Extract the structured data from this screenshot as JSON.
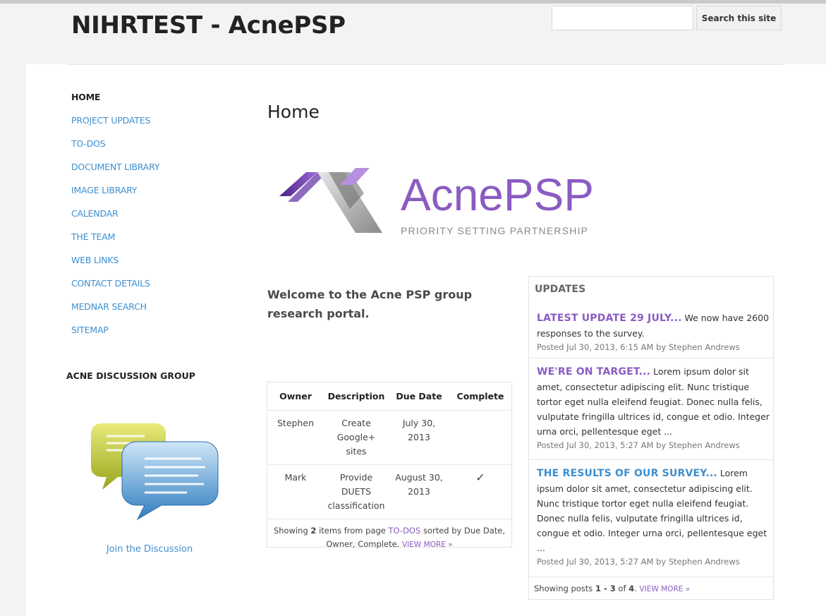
{
  "site": {
    "title": "NIHRTEST - AcnePSP",
    "search_button": "Search this site",
    "search_value": ""
  },
  "nav": {
    "items": [
      {
        "label": "HOME",
        "active": true
      },
      {
        "label": "PROJECT UPDATES"
      },
      {
        "label": "TO-DOS"
      },
      {
        "label": "DOCUMENT LIBRARY"
      },
      {
        "label": "IMAGE LIBRARY"
      },
      {
        "label": "CALENDAR"
      },
      {
        "label": "THE TEAM"
      },
      {
        "label": "WEB LINKS"
      },
      {
        "label": "CONTACT DETAILS"
      },
      {
        "label": "MEDNAR SEARCH"
      },
      {
        "label": "SITEMAP"
      }
    ]
  },
  "sidebar": {
    "group_title": "ACNE DISCUSSION GROUP",
    "image_icon": "chat-bubbles-icon",
    "join_link": "Join the Discussion"
  },
  "main": {
    "page_title": "Home",
    "logo": {
      "name": "AcnePSP",
      "tagline": "PRIORITY SETTING PARTNERSHIP"
    },
    "welcome": "Welcome to the Acne PSP group research portal.",
    "todos": {
      "headers": [
        "Owner",
        "Description",
        "Due Date",
        "Complete"
      ],
      "rows": [
        {
          "owner": "Stephen",
          "description": "Create Google+ sites",
          "due": "July 30, 2013",
          "complete": ""
        },
        {
          "owner": "Mark",
          "description": "Provide DUETS classification",
          "due": "August 30, 2013",
          "complete": "✓"
        }
      ],
      "footer": {
        "prefix": "Showing ",
        "count": "2",
        "mid": " items from page ",
        "page_link": "TO-DOS",
        "suffix": " sorted by Due Date, Owner, Complete. ",
        "view_more": "VIEW MORE »"
      }
    }
  },
  "updates": {
    "heading": "UPDATES",
    "posts": [
      {
        "title": "LATEST UPDATE 29 JULY...",
        "excerpt": " We now have 2600 responses to the survey.",
        "meta": "Posted Jul 30, 2013, 6:15 AM by Stephen Andrews"
      },
      {
        "title": "WE'RE ON TARGET...",
        "excerpt": " Lorem ipsum dolor sit amet, consectetur adipiscing elit. Nunc tristique tortor eget nulla eleifend feugiat. Donec nulla felis, vulputate fringilla ultrices id, congue et odio. Integer urna orci, pellentesque eget ...",
        "meta": "Posted Jul 30, 2013, 5:27 AM by Stephen Andrews"
      },
      {
        "title": "THE RESULTS OF OUR SURVEY...",
        "excerpt": " Lorem ipsum dolor sit amet, consectetur adipiscing elit. Nunc tristique tortor eget nulla eleifend feugiat. Donec nulla felis, vulputate fringilla ultrices id, congue et odio. Integer urna orci, pellentesque eget ...",
        "meta": "Posted Jul 30, 2013, 5:27 AM by Stephen Andrews"
      }
    ],
    "footer": {
      "prefix": "Showing posts ",
      "range": "1 - 3",
      "of": " of ",
      "total": "4",
      "dot": ". ",
      "view_more": "VIEW MORE »"
    }
  },
  "colors": {
    "link_blue": "#3d8fd0",
    "link_purple": "#8a5cc2",
    "check_green": "#3aa24a"
  }
}
